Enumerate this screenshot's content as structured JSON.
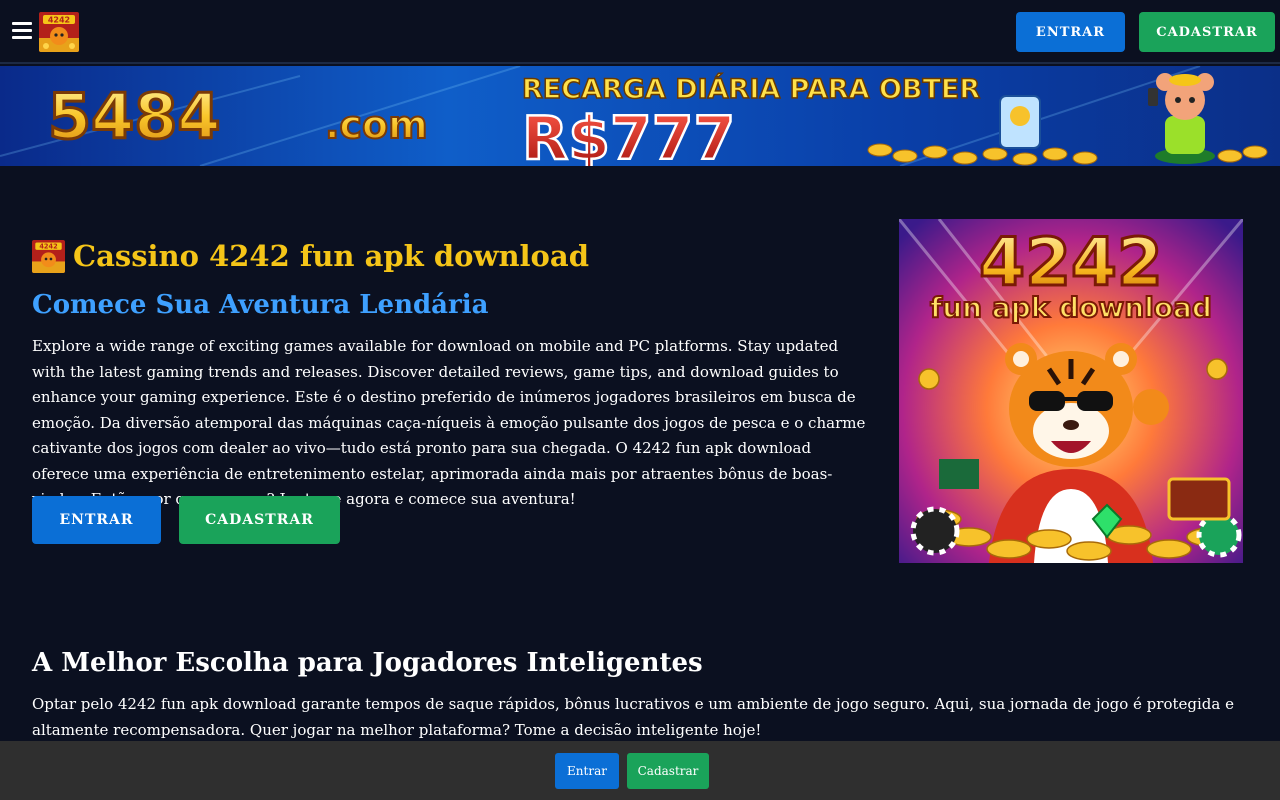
{
  "header": {
    "login_label": "ENTRAR",
    "register_label": "CADASTRAR",
    "logo_alt": "4242 fun"
  },
  "banner": {
    "brand": "5484.com",
    "headline": "RECARGA DIÁRIA PARA OBTER",
    "amount": "R$777"
  },
  "hero": {
    "title": "Cassino 4242 fun apk download",
    "subtitle": "Comece Sua Aventura Lendária",
    "intro": "Explore a wide range of exciting games available for download on mobile and PC platforms. Stay updated with the latest gaming trends and releases. Discover detailed reviews, game tips, and download guides to enhance your gaming experience. Este é o destino preferido de inúmeros jogadores brasileiros em busca de emoção. Da diversão atemporal das máquinas caça-níqueis à emoção pulsante dos jogos de pesca e o charme cativante dos jogos com dealer ao vivo—tudo está pronto para sua chegada. O 4242 fun apk download oferece uma experiência de entretenimento estelar, aprimorada ainda mais por atraentes bônus de boas-vindas. Então, por que esperar? Junte-se agora e comece sua aventura!",
    "login_label": "ENTRAR",
    "register_label": "CADASTRAR",
    "image_line1": "4242",
    "image_line2": "fun apk download"
  },
  "section2": {
    "title": "A Melhor Escolha para Jogadores Inteligentes",
    "text": "Optar pelo 4242 fun apk download garante tempos de saque rápidos, bônus lucrativos e um ambiente de jogo seguro. Aqui, sua jornada de jogo é protegida e altamente recompensadora. Quer jogar na melhor plataforma? Tome a decisão inteligente hoje!"
  },
  "bottom_bar": {
    "login_label": "Entrar",
    "register_label": "Cadastrar"
  },
  "icons": {
    "menu": "hamburger-menu-icon",
    "logo": "site-logo-icon"
  },
  "colors": {
    "background": "#0b1020",
    "title_gold": "#f5c518",
    "subtitle_blue": "#3ea0ff",
    "button_blue": "#0b6fd6",
    "button_green": "#1aa35a",
    "bottom_bar": "#2f2f2f"
  }
}
